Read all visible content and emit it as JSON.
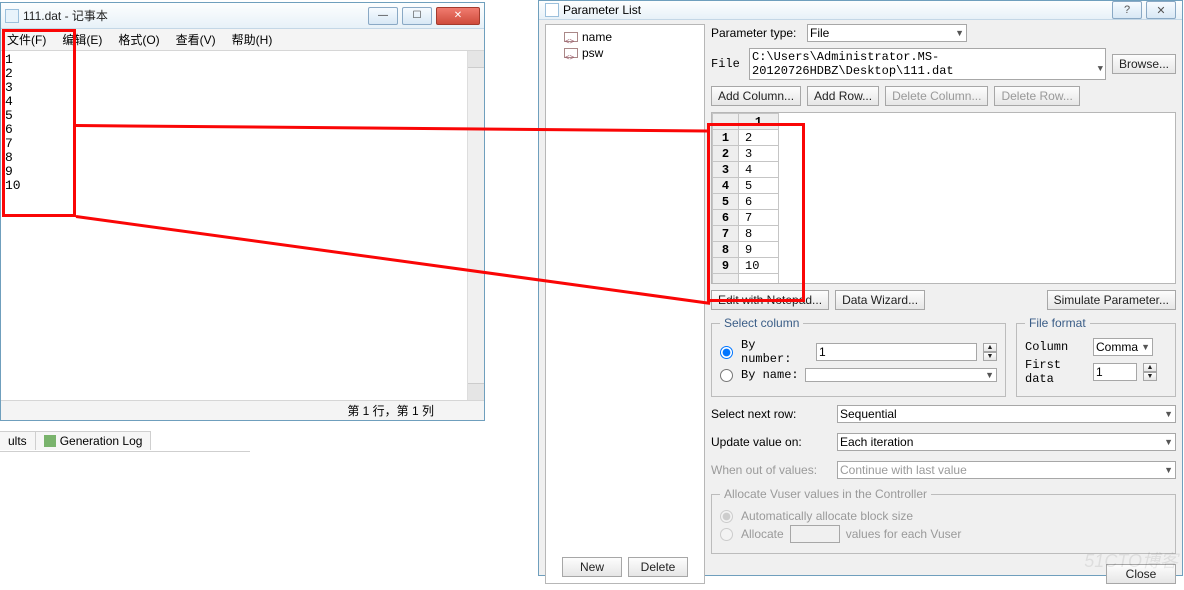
{
  "notepad": {
    "title": "111.dat - 记事本",
    "menu": {
      "file": "文件(F)",
      "edit": "编辑(E)",
      "format": "格式(O)",
      "view": "查看(V)",
      "help": "帮助(H)"
    },
    "content": "1\n2\n3\n4\n5\n6\n7\n8\n9\n10",
    "status": "第 1 行，第 1 列"
  },
  "tabs": {
    "ults": "ults",
    "genlog": "Generation Log"
  },
  "param": {
    "title": "Parameter List",
    "tree": {
      "items": [
        "name",
        "psw"
      ],
      "new": "New",
      "delete": "Delete"
    },
    "ptype_label": "Parameter type:",
    "ptype_value": "File",
    "file_label": "File",
    "file_value": "C:\\Users\\Administrator.MS-20120726HDBZ\\Desktop\\111.dat",
    "browse": "Browse...",
    "addcol": "Add Column...",
    "addrow": "Add Row...",
    "delcol": "Delete Column...",
    "delrow": "Delete Row...",
    "grid": {
      "header": "1",
      "rows": [
        {
          "idx": "1",
          "val": "2"
        },
        {
          "idx": "2",
          "val": "3"
        },
        {
          "idx": "3",
          "val": "4"
        },
        {
          "idx": "4",
          "val": "5"
        },
        {
          "idx": "5",
          "val": "6"
        },
        {
          "idx": "6",
          "val": "7"
        },
        {
          "idx": "7",
          "val": "8"
        },
        {
          "idx": "8",
          "val": "9"
        },
        {
          "idx": "9",
          "val": "10"
        }
      ]
    },
    "edit_notepad": "Edit with Notepad...",
    "data_wizard": "Data Wizard...",
    "sim_param": "Simulate Parameter...",
    "selcol": {
      "legend": "Select column",
      "bynum": "By number:",
      "bynum_val": "1",
      "byname": "By name:",
      "byname_val": ""
    },
    "fileformat": {
      "legend": "File format",
      "col_lbl": "Column",
      "col_val": "Comma",
      "first_lbl": "First data",
      "first_val": "1"
    },
    "selnext": {
      "label": "Select next row:",
      "value": "Sequential"
    },
    "updateon": {
      "label": "Update value on:",
      "value": "Each iteration"
    },
    "outof": {
      "label": "When out of values:",
      "value": "Continue with last value"
    },
    "alloc": {
      "legend": "Allocate Vuser values in the Controller",
      "auto": "Automatically allocate block size",
      "alloc": "Allocate",
      "alloc_suffix": "values for each Vuser"
    },
    "close": "Close"
  },
  "watermark": "51CTO博客"
}
